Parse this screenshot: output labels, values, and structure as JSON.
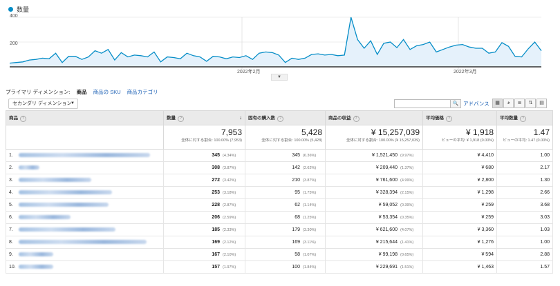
{
  "legend": {
    "label": "数量",
    "color": "#058dc7"
  },
  "chart_data": {
    "type": "area",
    "series": [
      {
        "name": "数量",
        "values": [
          30,
          35,
          40,
          55,
          60,
          70,
          65,
          110,
          35,
          85,
          85,
          60,
          80,
          130,
          110,
          140,
          55,
          115,
          80,
          95,
          90,
          80,
          120,
          40,
          80,
          75,
          65,
          110,
          90,
          80,
          45,
          85,
          80,
          65,
          80,
          75,
          90,
          60,
          110,
          120,
          115,
          95,
          35,
          70,
          60,
          70,
          100,
          105,
          95,
          100,
          90,
          95,
          400,
          220,
          150,
          210,
          100,
          190,
          200,
          155,
          220,
          140,
          170,
          180,
          200,
          120,
          140,
          160,
          175,
          180,
          160,
          150,
          150,
          110,
          120,
          195,
          165,
          85,
          80,
          145,
          200,
          130
        ]
      }
    ],
    "ylim": [
      0,
      400
    ],
    "y_ticks": [
      "400",
      "200"
    ],
    "x_ticks": [
      "2022年2月",
      "2022年3月"
    ]
  },
  "dimensions": {
    "label": "プライマリ ディメンション:",
    "current": "商品",
    "links": [
      "商品の SKU",
      "商品カテゴリ"
    ]
  },
  "secondary_dimension": {
    "label": "セカンダリ ディメンション"
  },
  "toolbar": {
    "advanced": "アドバンス"
  },
  "table": {
    "headers": [
      "商品",
      "数量",
      "固有の購入数",
      "商品の収益",
      "平均価格",
      "平均数量"
    ],
    "totals": [
      {
        "value": "7,953",
        "note": "全体に対する割合: 100.00% (7,953)"
      },
      {
        "value": "5,428",
        "note": "全体に対する割合: 100.00% (5,428)"
      },
      {
        "value": "¥ 15,257,039",
        "note": "全体に対する割合: 100.00% (¥ 15,257,039)"
      },
      {
        "value": "¥ 1,918",
        "note": "ビューの平均: ¥ 1,918 (0.00%)"
      },
      {
        "value": "1.47",
        "note": "ビューの平均: 1.47 (0.00%)"
      }
    ],
    "rows": [
      {
        "idx": "1.",
        "name_w": 190,
        "qty": "345",
        "qty_pct": "(4.34%)",
        "uniq": "345",
        "uniq_pct": "(6.36%)",
        "rev": "¥ 1,521,450",
        "rev_pct": "(9.97%)",
        "price": "¥ 4,410",
        "avg": "1.00"
      },
      {
        "idx": "2.",
        "name_w": 30,
        "qty": "308",
        "qty_pct": "(3.87%)",
        "uniq": "142",
        "uniq_pct": "(2.62%)",
        "rev": "¥ 209,440",
        "rev_pct": "(1.37%)",
        "price": "¥ 680",
        "avg": "2.17"
      },
      {
        "idx": "3.",
        "name_w": 105,
        "qty": "272",
        "qty_pct": "(3.42%)",
        "uniq": "210",
        "uniq_pct": "(3.87%)",
        "rev": "¥ 761,600",
        "rev_pct": "(4.99%)",
        "price": "¥ 2,800",
        "avg": "1.30"
      },
      {
        "idx": "4.",
        "name_w": 135,
        "qty": "253",
        "qty_pct": "(3.18%)",
        "uniq": "95",
        "uniq_pct": "(1.75%)",
        "rev": "¥ 328,394",
        "rev_pct": "(2.15%)",
        "price": "¥ 1,298",
        "avg": "2.66"
      },
      {
        "idx": "5.",
        "name_w": 130,
        "qty": "228",
        "qty_pct": "(2.87%)",
        "uniq": "62",
        "uniq_pct": "(1.14%)",
        "rev": "¥ 59,052",
        "rev_pct": "(0.39%)",
        "price": "¥ 259",
        "avg": "3.68"
      },
      {
        "idx": "6.",
        "name_w": 75,
        "qty": "206",
        "qty_pct": "(2.59%)",
        "uniq": "68",
        "uniq_pct": "(1.25%)",
        "rev": "¥ 53,354",
        "rev_pct": "(0.35%)",
        "price": "¥ 259",
        "avg": "3.03"
      },
      {
        "idx": "7.",
        "name_w": 140,
        "qty": "185",
        "qty_pct": "(2.33%)",
        "uniq": "179",
        "uniq_pct": "(3.30%)",
        "rev": "¥ 621,600",
        "rev_pct": "(4.07%)",
        "price": "¥ 3,360",
        "avg": "1.03"
      },
      {
        "idx": "8.",
        "name_w": 185,
        "qty": "169",
        "qty_pct": "(2.12%)",
        "uniq": "169",
        "uniq_pct": "(3.11%)",
        "rev": "¥ 215,644",
        "rev_pct": "(1.41%)",
        "price": "¥ 1,276",
        "avg": "1.00"
      },
      {
        "idx": "9.",
        "name_w": 50,
        "qty": "167",
        "qty_pct": "(2.10%)",
        "uniq": "58",
        "uniq_pct": "(1.07%)",
        "rev": "¥ 99,198",
        "rev_pct": "(0.65%)",
        "price": "¥ 594",
        "avg": "2.88"
      },
      {
        "idx": "10.",
        "name_w": 50,
        "qty": "157",
        "qty_pct": "(1.97%)",
        "uniq": "100",
        "uniq_pct": "(1.84%)",
        "rev": "¥ 229,691",
        "rev_pct": "(1.51%)",
        "price": "¥ 1,463",
        "avg": "1.57"
      }
    ]
  }
}
